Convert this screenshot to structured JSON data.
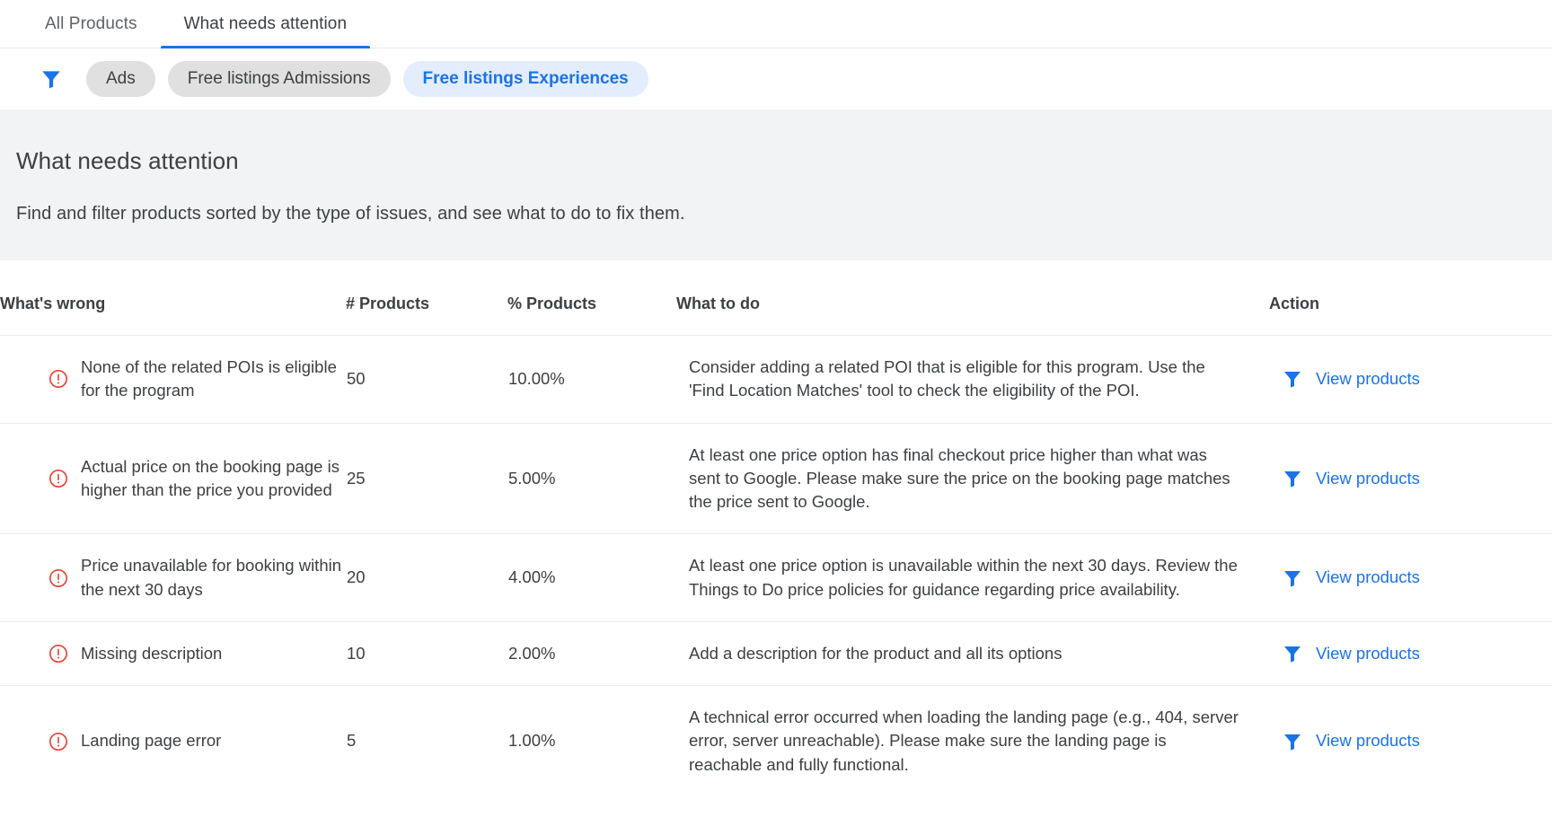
{
  "colors": {
    "accent": "#1a73e8",
    "error": "#ea4335",
    "chip_bg": "#e0e0e0",
    "chip_selected_bg": "#e4edfd",
    "banner_bg": "#f1f3f4",
    "text": "#3c4043",
    "muted_text": "#5f6368",
    "divider": "#e8eaed"
  },
  "tabs": [
    {
      "label": "All Products",
      "active": false
    },
    {
      "label": "What needs attention",
      "active": true
    }
  ],
  "filters": {
    "icon": "filter-funnel-icon",
    "chips": [
      {
        "label": "Ads",
        "selected": false
      },
      {
        "label": "Free listings Admissions",
        "selected": false
      },
      {
        "label": "Free listings Experiences",
        "selected": true
      }
    ]
  },
  "banner": {
    "title": "What needs attention",
    "description": "Find and filter products sorted by the type of issues, and see what to do to fix them."
  },
  "table": {
    "columns": [
      "What's wrong",
      "# Products",
      "% Products",
      "What to do",
      "Action"
    ],
    "action_label": "View products",
    "row_icon": "error-circle-icon",
    "action_icon": "filter-funnel-icon",
    "rows": [
      {
        "whats_wrong": "None of the related POIs is eligible for the program",
        "num_products": "50",
        "pct_products": "10.00%",
        "what_to_do": "Consider adding a related POI that is eligible for this program. Use the 'Find Location Matches' tool to check the eligibility of the POI.",
        "action": "View products"
      },
      {
        "whats_wrong": "Actual price on the booking page is higher than the price you provided",
        "num_products": "25",
        "pct_products": "5.00%",
        "what_to_do": "At least one price option has final checkout price higher than what was sent to Google. Please make sure the price on the booking page matches the price sent to Google.",
        "action": "View products"
      },
      {
        "whats_wrong": "Price unavailable for booking within the next 30 days",
        "num_products": "20",
        "pct_products": "4.00%",
        "what_to_do": "At least one price option is unavailable within the next 30 days. Review the Things to Do price policies for guidance regarding price availability.",
        "action": "View products"
      },
      {
        "whats_wrong": "Missing description",
        "num_products": "10",
        "pct_products": "2.00%",
        "what_to_do": "Add a description for the product and all its options",
        "action": "View products"
      },
      {
        "whats_wrong": "Landing page error",
        "num_products": "5",
        "pct_products": "1.00%",
        "what_to_do": "A technical error occurred when loading the landing page (e.g., 404, server error, server unreachable). Please make sure the landing page is reachable and fully functional.",
        "action": "View products"
      }
    ]
  }
}
